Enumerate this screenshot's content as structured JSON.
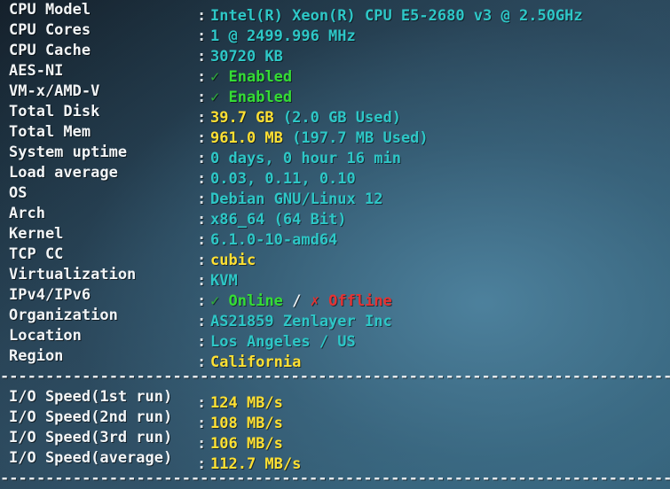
{
  "terminal": {
    "separator": "---------------------------------------------------------------------------",
    "colors": {
      "background_dark": "#1d303e",
      "background_light": "#376780",
      "label": "#f2f5f7",
      "cyan": "#2ec7c7",
      "yellow": "#ffe033",
      "green": "#35dd35",
      "red": "#e53232",
      "white": "#eef2f5"
    },
    "system_info": [
      {
        "label": "CPU Model",
        "value": "Intel(R) Xeon(R) CPU E5-2680 v3 @ 2.50GHz",
        "color": "cyan"
      },
      {
        "label": "CPU Cores",
        "value": "1 @ 2499.996 MHz",
        "color": "cyan"
      },
      {
        "label": "CPU Cache",
        "value": "30720 KB",
        "color": "cyan"
      },
      {
        "label": "AES-NI",
        "value": "Enabled",
        "color": "green",
        "icon": "check-icon",
        "icon_glyph": "✓"
      },
      {
        "label": "VM-x/AMD-V",
        "value": "Enabled",
        "color": "green",
        "icon": "check-icon",
        "icon_glyph": "✓"
      },
      {
        "label": "Total Disk",
        "value": "39.7 GB",
        "color": "yellow",
        "suffix": "(2.0 GB Used)",
        "suffix_color": "cyan"
      },
      {
        "label": "Total Mem",
        "value": "961.0 MB",
        "color": "yellow",
        "suffix": "(197.7 MB Used)",
        "suffix_color": "cyan"
      },
      {
        "label": "System uptime",
        "value": "0 days, 0 hour 16 min",
        "color": "cyan"
      },
      {
        "label": "Load average",
        "value": "0.03, 0.11, 0.10",
        "color": "cyan"
      },
      {
        "label": "OS",
        "value": "Debian GNU/Linux 12",
        "color": "cyan"
      },
      {
        "label": "Arch",
        "value": "x86_64 (64 Bit)",
        "color": "cyan"
      },
      {
        "label": "Kernel",
        "value": "6.1.0-10-amd64",
        "color": "cyan"
      },
      {
        "label": "TCP CC",
        "value": "cubic",
        "color": "yellow"
      },
      {
        "label": "Virtualization",
        "value": "KVM",
        "color": "cyan"
      },
      {
        "label": "IPv4/IPv6",
        "value": "Online / Offline",
        "color": "green",
        "ipv4_status": "Online",
        "ipv6_status": "Offline",
        "ipv4_icon": "check-icon",
        "ipv6_icon": "cross-icon",
        "ipv4_glyph": "✓",
        "ipv6_glyph": "✗",
        "divider": "/"
      },
      {
        "label": "Organization",
        "value": "AS21859 Zenlayer Inc",
        "color": "cyan"
      },
      {
        "label": "Location",
        "value": "Los Angeles / US",
        "color": "cyan"
      },
      {
        "label": "Region",
        "value": "California",
        "color": "yellow"
      }
    ],
    "io_speed": [
      {
        "label": "I/O Speed(1st run)",
        "value": "124 MB/s",
        "color": "yellow"
      },
      {
        "label": "I/O Speed(2nd run)",
        "value": "108 MB/s",
        "color": "yellow"
      },
      {
        "label": "I/O Speed(3rd run)",
        "value": "106 MB/s",
        "color": "yellow"
      },
      {
        "label": "I/O Speed(average)",
        "value": "112.7 MB/s",
        "color": "yellow"
      }
    ]
  }
}
